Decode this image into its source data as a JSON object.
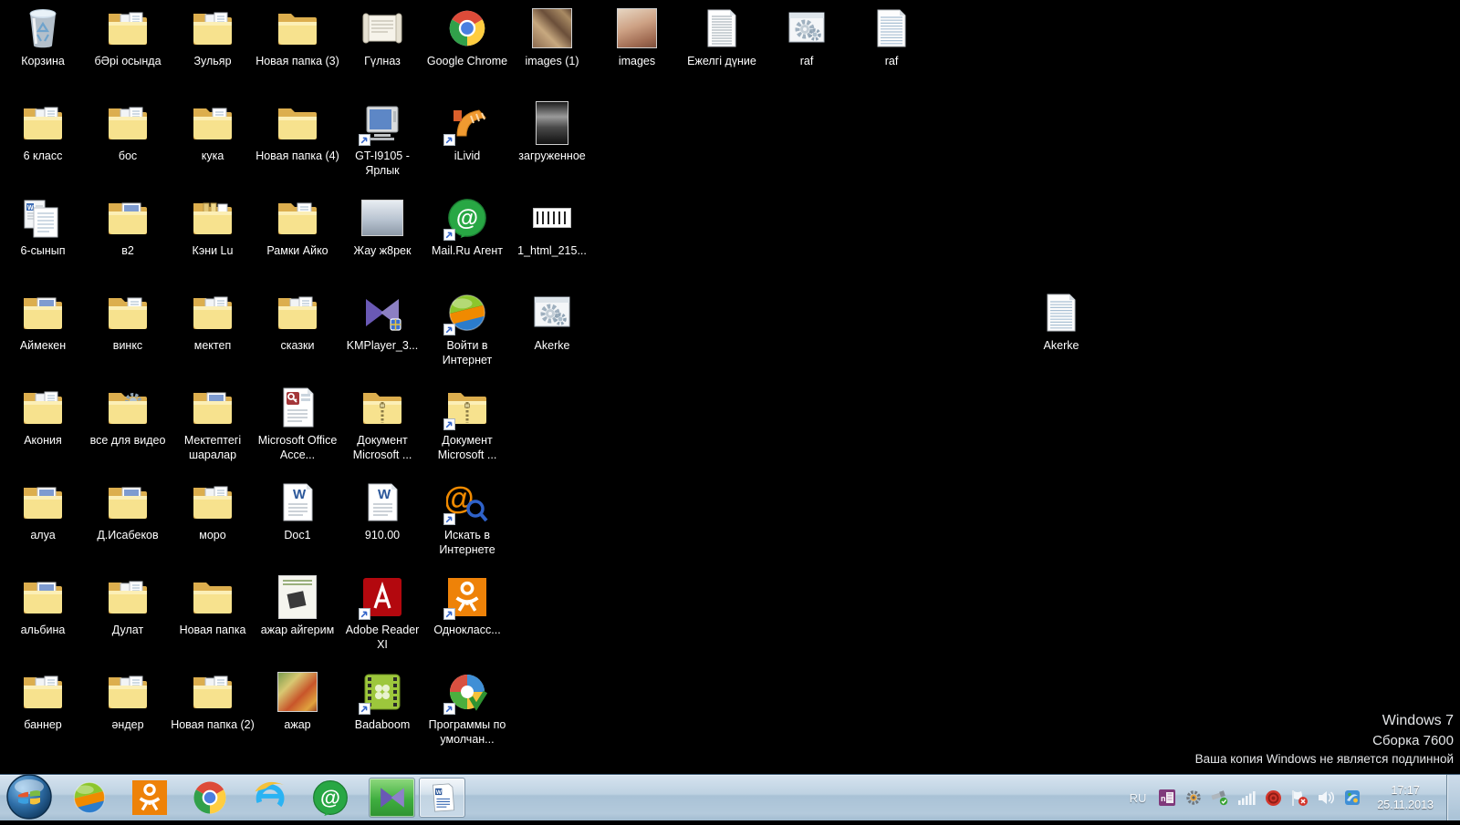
{
  "desktop": {
    "background": "#000000",
    "icons": [
      {
        "label": "Корзина",
        "icon": "recycle-bin-icon",
        "type": "recycle",
        "col": 0,
        "row": 0
      },
      {
        "label": "бӘрі осында",
        "icon": "folder-icon",
        "type": "folder-docs",
        "col": 1,
        "row": 0
      },
      {
        "label": "Зульяр",
        "icon": "folder-icon",
        "type": "folder-docs",
        "col": 2,
        "row": 0
      },
      {
        "label": "Новая папка (3)",
        "icon": "folder-icon",
        "type": "folder",
        "col": 3,
        "row": 0
      },
      {
        "label": "Гүлназ",
        "icon": "scroll-document-icon",
        "type": "scroll",
        "col": 4,
        "row": 0
      },
      {
        "label": "Google Chrome",
        "icon": "chrome-icon",
        "type": "chrome",
        "col": 5,
        "row": 0
      },
      {
        "label": "images (1)",
        "icon": "photo-thumbnail-icon",
        "type": "ph-collage",
        "col": 6,
        "row": 0
      },
      {
        "label": "images",
        "icon": "photo-thumbnail-icon",
        "type": "ph-baby",
        "col": 7,
        "row": 0
      },
      {
        "label": "Ежелгі дүние",
        "icon": "text-document-icon",
        "type": "docpage",
        "col": 8,
        "row": 0
      },
      {
        "label": "raf",
        "icon": "settings-window-icon",
        "type": "gearwin",
        "col": 9,
        "row": 0
      },
      {
        "label": "raf",
        "icon": "notepad-file-icon",
        "type": "notepad",
        "col": 10,
        "row": 0
      },
      {
        "label": "6 класс",
        "icon": "folder-icon",
        "type": "folder-docs",
        "col": 0,
        "row": 1
      },
      {
        "label": "бос",
        "icon": "folder-icon",
        "type": "folder-docs",
        "col": 1,
        "row": 1
      },
      {
        "label": "кука",
        "icon": "folder-icon",
        "type": "folder-file",
        "col": 2,
        "row": 1
      },
      {
        "label": "Новая папка (4)",
        "icon": "folder-icon",
        "type": "folder",
        "col": 3,
        "row": 1
      },
      {
        "label": "GT-I9105 - Ярлык",
        "icon": "device-shortcut-icon",
        "type": "phone",
        "col": 4,
        "row": 1
      },
      {
        "label": "iLivid",
        "icon": "ilivid-icon",
        "type": "ilivid",
        "col": 5,
        "row": 1
      },
      {
        "label": "загруженное",
        "icon": "photo-thumbnail-icon",
        "type": "ph-bw",
        "col": 6,
        "row": 1
      },
      {
        "label": "6-сынып",
        "icon": "word-documents-icon",
        "type": "worddocs",
        "col": 0,
        "row": 2
      },
      {
        "label": "в2",
        "icon": "folder-icon",
        "type": "folder-photo",
        "col": 1,
        "row": 2
      },
      {
        "label": "Кэни Lu",
        "icon": "folder-icon",
        "type": "folder-files",
        "col": 2,
        "row": 2
      },
      {
        "label": "Рамки Айко",
        "icon": "folder-icon",
        "type": "folder-file",
        "col": 3,
        "row": 2
      },
      {
        "label": "Жау ж8рек",
        "icon": "photo-thumbnail-icon",
        "type": "ph-building",
        "col": 4,
        "row": 2
      },
      {
        "label": "Mail.Ru Агент",
        "icon": "mailru-agent-shortcut-icon",
        "type": "mailru",
        "col": 5,
        "row": 2
      },
      {
        "label": "1_html_215...",
        "icon": "photo-thumbnail-icon",
        "type": "ph-small",
        "col": 6,
        "row": 2
      },
      {
        "label": "Аймекен",
        "icon": "folder-icon",
        "type": "folder-photo",
        "col": 0,
        "row": 3
      },
      {
        "label": "винкс",
        "icon": "folder-icon",
        "type": "folder-file",
        "col": 1,
        "row": 3
      },
      {
        "label": "мектеп",
        "icon": "folder-icon",
        "type": "folder-docs",
        "col": 2,
        "row": 3
      },
      {
        "label": "сказки",
        "icon": "folder-icon",
        "type": "folder-docs",
        "col": 3,
        "row": 3
      },
      {
        "label": "KMPlayer_3...",
        "icon": "kmplayer-icon",
        "type": "kmplayer",
        "col": 4,
        "row": 3
      },
      {
        "label": "Войти в Интернет",
        "icon": "internet-sphere-shortcut-icon",
        "type": "sphere",
        "col": 5,
        "row": 3
      },
      {
        "label": "Akerke",
        "icon": "settings-window-icon",
        "type": "gearwin",
        "col": 6,
        "row": 3
      },
      {
        "label": "Akerke",
        "icon": "notepad-file-icon",
        "type": "notepad",
        "col": 12,
        "row": 3
      },
      {
        "label": "Акония",
        "icon": "folder-icon",
        "type": "folder-docs",
        "col": 0,
        "row": 4
      },
      {
        "label": "все для видео",
        "icon": "folder-icon",
        "type": "folder-gear",
        "col": 1,
        "row": 4
      },
      {
        "label": "Мектептегі шаралар",
        "icon": "folder-icon",
        "type": "folder-photo",
        "col": 2,
        "row": 4
      },
      {
        "label": "Microsoft Office Acce...",
        "icon": "access-document-icon",
        "type": "access",
        "col": 3,
        "row": 4
      },
      {
        "label": "Документ Microsoft ...",
        "icon": "zip-folder-icon",
        "type": "folder-zip",
        "col": 4,
        "row": 4
      },
      {
        "label": "Документ Microsoft ...",
        "icon": "zip-folder-shortcut-icon",
        "type": "folder-zip-arrow",
        "col": 5,
        "row": 4
      },
      {
        "label": "алуа",
        "icon": "folder-icon",
        "type": "folder-photo",
        "col": 0,
        "row": 5
      },
      {
        "label": "Д.Исабеков",
        "icon": "folder-icon",
        "type": "folder-photo",
        "col": 1,
        "row": 5
      },
      {
        "label": "моро",
        "icon": "folder-icon",
        "type": "folder-docs",
        "col": 2,
        "row": 5
      },
      {
        "label": "Doc1",
        "icon": "word-document-icon",
        "type": "worddoc",
        "col": 3,
        "row": 5
      },
      {
        "label": "910.00",
        "icon": "word-document-icon",
        "type": "worddoc",
        "col": 4,
        "row": 5
      },
      {
        "label": "Искать в Интернете",
        "icon": "search-internet-shortcut-icon",
        "type": "search",
        "col": 5,
        "row": 5
      },
      {
        "label": "альбина",
        "icon": "folder-icon",
        "type": "folder-photo",
        "col": 0,
        "row": 6
      },
      {
        "label": "Дулат",
        "icon": "folder-icon",
        "type": "folder-docs",
        "col": 1,
        "row": 6
      },
      {
        "label": "Новая папка",
        "icon": "folder-icon",
        "type": "folder",
        "col": 2,
        "row": 6
      },
      {
        "label": "ажар айгерим",
        "icon": "photo-thumbnail-icon",
        "type": "ph-doc",
        "col": 3,
        "row": 6
      },
      {
        "label": "Adobe Reader XI",
        "icon": "adobe-reader-shortcut-icon",
        "type": "adobe",
        "col": 4,
        "row": 6
      },
      {
        "label": "Однокласс...",
        "icon": "odnoklassniki-shortcut-icon",
        "type": "ok",
        "col": 5,
        "row": 6
      },
      {
        "label": "баннер",
        "icon": "folder-icon",
        "type": "folder-docs",
        "col": 0,
        "row": 7
      },
      {
        "label": "әндер",
        "icon": "folder-icon",
        "type": "folder-docs",
        "col": 1,
        "row": 7
      },
      {
        "label": "Новая папка (2)",
        "icon": "folder-icon",
        "type": "folder-docs",
        "col": 2,
        "row": 7
      },
      {
        "label": "ажар",
        "icon": "photo-thumbnail-icon",
        "type": "ph-color",
        "col": 3,
        "row": 7
      },
      {
        "label": "Badaboom",
        "icon": "badaboom-shortcut-icon",
        "type": "badaboom",
        "col": 4,
        "row": 7
      },
      {
        "label": "Программы по умолчан...",
        "icon": "default-programs-shortcut-icon",
        "type": "defaults",
        "col": 5,
        "row": 7
      }
    ]
  },
  "system": {
    "line1": "Windows 7",
    "line2": "Сборка 7600",
    "line3": "Ваша копия Windows не является подлинной"
  },
  "taskbar": {
    "pinned": [
      {
        "icon": "internet-sphere-icon",
        "type": "sphere-plain"
      },
      {
        "icon": "odnoklassniki-icon",
        "type": "ok-plain"
      },
      {
        "icon": "chrome-icon",
        "type": "chrome"
      },
      {
        "icon": "internet-explorer-icon",
        "type": "ie"
      },
      {
        "icon": "mailru-agent-icon",
        "type": "mailru-plain"
      }
    ],
    "windows": [
      {
        "icon": "kmplayer-window-button",
        "type": "kmplayer-btn",
        "active": true
      },
      {
        "icon": "word-window-button",
        "type": "word-btn",
        "active": false
      }
    ],
    "tray": {
      "language": "RU",
      "icons": [
        {
          "icon": "onenote-tray-icon",
          "type": "tr-onenote"
        },
        {
          "icon": "gear-tray-icon",
          "type": "tr-gear"
        },
        {
          "icon": "safely-remove-hardware-icon",
          "type": "tr-usb"
        },
        {
          "icon": "network-signal-icon",
          "type": "tr-net"
        },
        {
          "icon": "mailru-tray-icon",
          "type": "tr-red"
        },
        {
          "icon": "action-center-flag-icon",
          "type": "tr-flag"
        },
        {
          "icon": "volume-icon",
          "type": "tr-vol"
        },
        {
          "icon": "windows-update-icon",
          "type": "tr-upd"
        }
      ],
      "time": "17:17",
      "date": "25.11.2013"
    }
  }
}
